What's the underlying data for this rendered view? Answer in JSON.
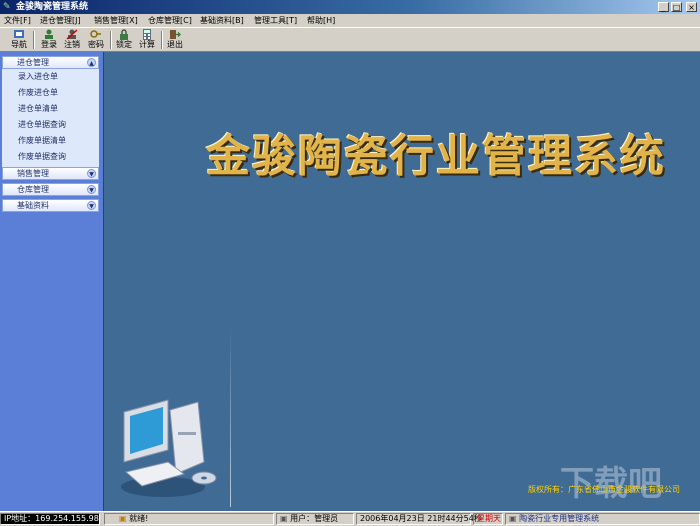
{
  "window": {
    "title": "金骏陶瓷管理系统",
    "buttons": [
      "_",
      "□",
      "×"
    ]
  },
  "menu": [
    "文件[F]",
    "进仓管理[J]",
    "销售管理[X]",
    "仓库管理[C]",
    "基础资料[B]",
    "管理工具[T]",
    "帮助[H]"
  ],
  "toolbar": [
    {
      "label": "导航",
      "icon": "navigation-icon"
    },
    {
      "label": "登录",
      "icon": "login-icon"
    },
    {
      "label": "注销",
      "icon": "logout-user-icon"
    },
    {
      "label": "密码",
      "icon": "password-icon"
    },
    {
      "label": "锁定",
      "icon": "lock-icon"
    },
    {
      "label": "计算",
      "icon": "calculator-icon"
    },
    {
      "label": "退出",
      "icon": "exit-icon"
    }
  ],
  "sidebar": {
    "groups": [
      {
        "label": "进仓管理",
        "expanded": true,
        "items": [
          "录入进仓单",
          "作废进仓单",
          "进仓单清单",
          "进仓单据查询",
          "作废单据清单",
          "作废单据查询"
        ]
      },
      {
        "label": "销售管理",
        "expanded": false
      },
      {
        "label": "仓库管理",
        "expanded": false
      },
      {
        "label": "基础资料",
        "expanded": false
      }
    ]
  },
  "main": {
    "heading": "金骏陶瓷行业管理系统",
    "copyright": "版权所有：广东省佛山市金骏软件有限公司",
    "watermark": "下载吧",
    "background_color": "#3f6b95",
    "heading_color": "#e0b44a"
  },
  "status": {
    "ip": "IP地址：169.254.155.98",
    "state": "就绪!",
    "user": "用户：管理员",
    "datetime": "2006年04月23日  21时44分54秒",
    "weekday": "星期天",
    "product": "陶瓷行业专用管理系统"
  }
}
